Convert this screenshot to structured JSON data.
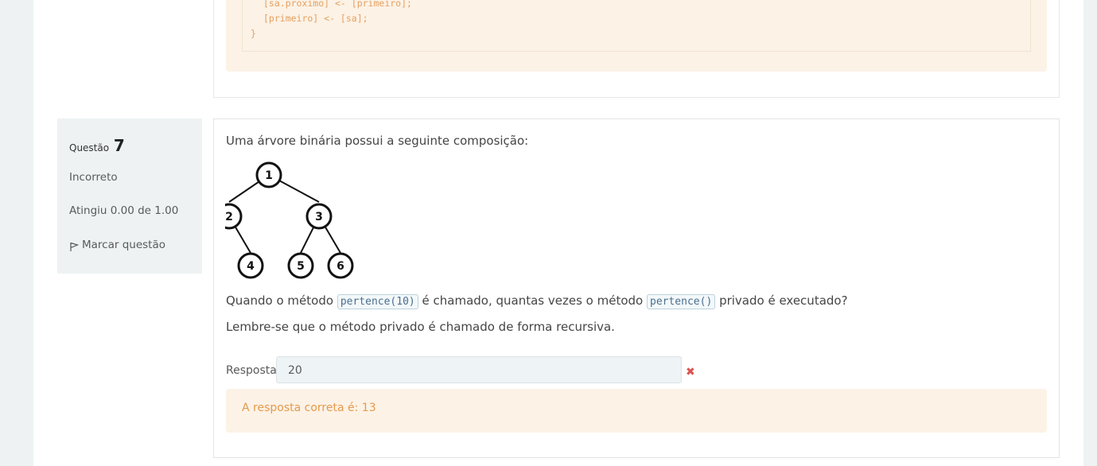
{
  "previous_question": {
    "code_lines": [
      "[sa.proximo] <- [primeiro];",
      "[primeiro] <- [sa];",
      "}"
    ]
  },
  "question": {
    "label": "Questão",
    "number": "7",
    "state": "Incorreto",
    "grade": "Atingiu 0.00 de 1.00",
    "flag_label": "Marcar questão",
    "text_intro": "Uma árvore binária possui a seguinte composição:",
    "tree_nodes": [
      "1",
      "2",
      "3",
      "4",
      "5",
      "6"
    ],
    "text_q_part1": "Quando o método",
    "code1": "pertence(10)",
    "text_q_part2": "é chamado, quantas vezes o método",
    "code2": "pertence()",
    "text_q_part3": "privado é executado?",
    "text_hint": "Lembre-se que o método privado é chamado de forma recursiva.",
    "answer_label": "Resposta:",
    "answer_value": "20",
    "correct_answer_text": "A resposta correta é: 13"
  },
  "colors": {
    "incorrect_mark": "#d9534f",
    "feedback_bg": "#fcf2e6",
    "feedback_text": "#e49b4e"
  },
  "icons": [
    "flag-icon",
    "incorrect-x-icon"
  ]
}
